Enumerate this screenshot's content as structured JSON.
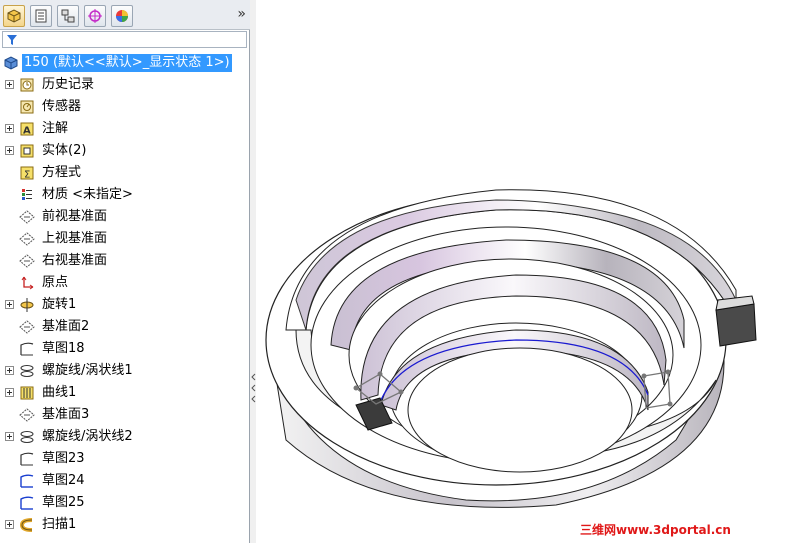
{
  "tabs": [
    {
      "icon": "feature-manager-icon"
    },
    {
      "icon": "property-manager-icon"
    },
    {
      "icon": "configuration-manager-icon"
    },
    {
      "icon": "dimxpert-icon"
    },
    {
      "icon": "display-manager-icon"
    }
  ],
  "tabs_more": "»",
  "root": {
    "label": "150  (默认<<默认>_显示状态 1>)",
    "icon": "part-icon"
  },
  "tree": [
    {
      "label": "历史记录",
      "icon": "history-icon",
      "expandable": true
    },
    {
      "label": "传感器",
      "icon": "sensor-icon",
      "expandable": false
    },
    {
      "label": "注解",
      "icon": "annotations-icon",
      "expandable": true
    },
    {
      "label": "实体(2)",
      "icon": "solid-bodies-icon",
      "expandable": true
    },
    {
      "label": "方程式",
      "icon": "equations-icon",
      "expandable": false
    },
    {
      "label": "材质 <未指定>",
      "icon": "material-icon",
      "expandable": false
    },
    {
      "label": "前视基准面",
      "icon": "plane-icon",
      "expandable": false
    },
    {
      "label": "上视基准面",
      "icon": "plane-icon",
      "expandable": false
    },
    {
      "label": "右视基准面",
      "icon": "plane-icon",
      "expandable": false
    },
    {
      "label": "原点",
      "icon": "origin-icon",
      "expandable": false
    },
    {
      "label": "旋转1",
      "icon": "revolve-icon",
      "expandable": true
    },
    {
      "label": "基准面2",
      "icon": "plane-icon",
      "expandable": false
    },
    {
      "label": "草图18",
      "icon": "sketch-icon",
      "expandable": false
    },
    {
      "label": "螺旋线/涡状线1",
      "icon": "helix-icon",
      "expandable": true
    },
    {
      "label": "曲线1",
      "icon": "curve-icon",
      "expandable": true
    },
    {
      "label": "基准面3",
      "icon": "plane-icon",
      "expandable": false
    },
    {
      "label": "螺旋线/涡状线2",
      "icon": "helix-icon",
      "expandable": true
    },
    {
      "label": "草图23",
      "icon": "sketch-icon",
      "expandable": false
    },
    {
      "label": "草图24",
      "icon": "sketch-blue-icon",
      "expandable": false
    },
    {
      "label": "草图25",
      "icon": "sketch-blue-icon",
      "expandable": false
    },
    {
      "label": "扫描1",
      "icon": "sweep-icon",
      "expandable": true
    }
  ],
  "watermark": "三维网www.3dportal.cn",
  "colors": {
    "selection": "#3399ff",
    "model_light": "#ffffff",
    "model_shade": "#cbc3d4",
    "helix": "#1a1ad0"
  }
}
